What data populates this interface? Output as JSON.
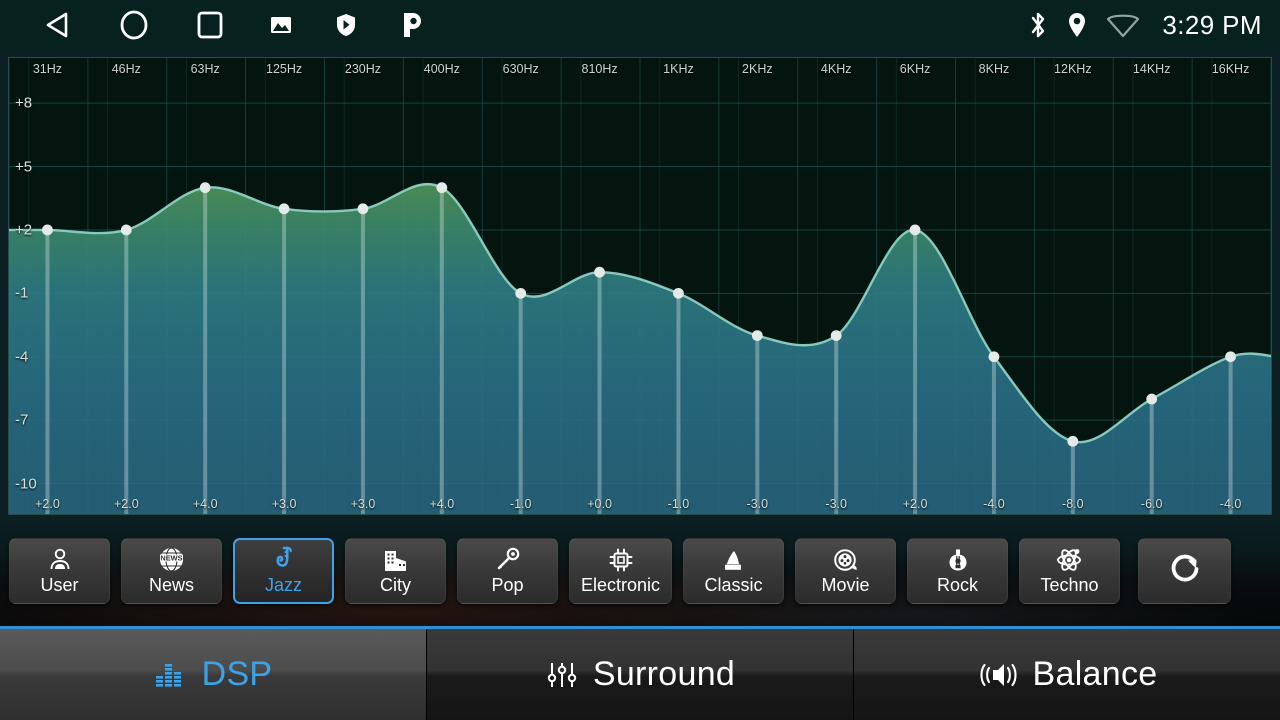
{
  "statusbar": {
    "nav_icons": [
      "back-icon",
      "home-icon",
      "recents-icon",
      "gallery-icon",
      "shield-icon",
      "pandora-icon"
    ],
    "system_icons": [
      "bluetooth-icon",
      "location-icon",
      "wifi-icon"
    ],
    "time": "3:29 PM"
  },
  "chart_data": {
    "type": "line",
    "title": "",
    "xlabel": "",
    "ylabel": "",
    "ylim": [
      -10,
      9
    ],
    "grid": true,
    "legend": "none",
    "categories": [
      "31Hz",
      "46Hz",
      "63Hz",
      "125Hz",
      "230Hz",
      "400Hz",
      "630Hz",
      "810Hz",
      "1KHz",
      "2KHz",
      "4KHz",
      "6KHz",
      "8KHz",
      "12KHz",
      "14KHz",
      "16KHz"
    ],
    "values": [
      2.0,
      2.0,
      4.0,
      3.0,
      3.0,
      4.0,
      -1.0,
      0.0,
      -1.0,
      -3.0,
      -3.0,
      2.0,
      -4.0,
      -8.0,
      -6.0,
      -4.0
    ],
    "value_labels": [
      "+2.0",
      "+2.0",
      "+4.0",
      "+3.0",
      "+3.0",
      "+4.0",
      "-1.0",
      "+0.0",
      "-1.0",
      "-3.0",
      "-3.0",
      "+2.0",
      "-4.0",
      "-8.0",
      "-6.0",
      "-4.0"
    ],
    "ytick_labels": [
      "+8",
      "+5",
      "+2",
      "-1",
      "-4",
      "-7",
      "-10"
    ],
    "ytick_values": [
      8,
      5,
      2,
      -1,
      -4,
      -7,
      -10
    ],
    "curve_color": "#8fd6c8",
    "fill_top_color": "#6f9a35",
    "fill_bottom_color": "#2a6f86",
    "node_color": "#e4eae8",
    "grid_color": "#1d4c48",
    "plot_bg": "#04140f"
  },
  "presets": {
    "items": [
      {
        "label": "User",
        "icon": "user-icon",
        "active": false
      },
      {
        "label": "News",
        "icon": "news-globe-icon",
        "active": false
      },
      {
        "label": "Jazz",
        "icon": "saxophone-icon",
        "active": true
      },
      {
        "label": "City",
        "icon": "buildings-icon",
        "active": false
      },
      {
        "label": "Pop",
        "icon": "microphone-icon",
        "active": false
      },
      {
        "label": "Electronic",
        "icon": "cpu-chip-icon",
        "active": false
      },
      {
        "label": "Classic",
        "icon": "gramophone-icon",
        "active": false
      },
      {
        "label": "Movie",
        "icon": "film-reel-icon",
        "active": false
      },
      {
        "label": "Rock",
        "icon": "guitar-icon",
        "active": false
      },
      {
        "label": "Techno",
        "icon": "atom-icon",
        "active": false
      }
    ],
    "reset": {
      "label": "",
      "icon": "refresh-icon"
    }
  },
  "tabs": [
    {
      "label": "DSP",
      "icon": "equalizer-bars-icon",
      "active": true
    },
    {
      "label": "Surround",
      "icon": "sliders-icon",
      "active": false
    },
    {
      "label": "Balance",
      "icon": "speaker-waves-icon",
      "active": false
    }
  ],
  "colors": {
    "accent": "#3da3e8",
    "text": "#ffffff",
    "statusbar_bg": "#07211f"
  }
}
